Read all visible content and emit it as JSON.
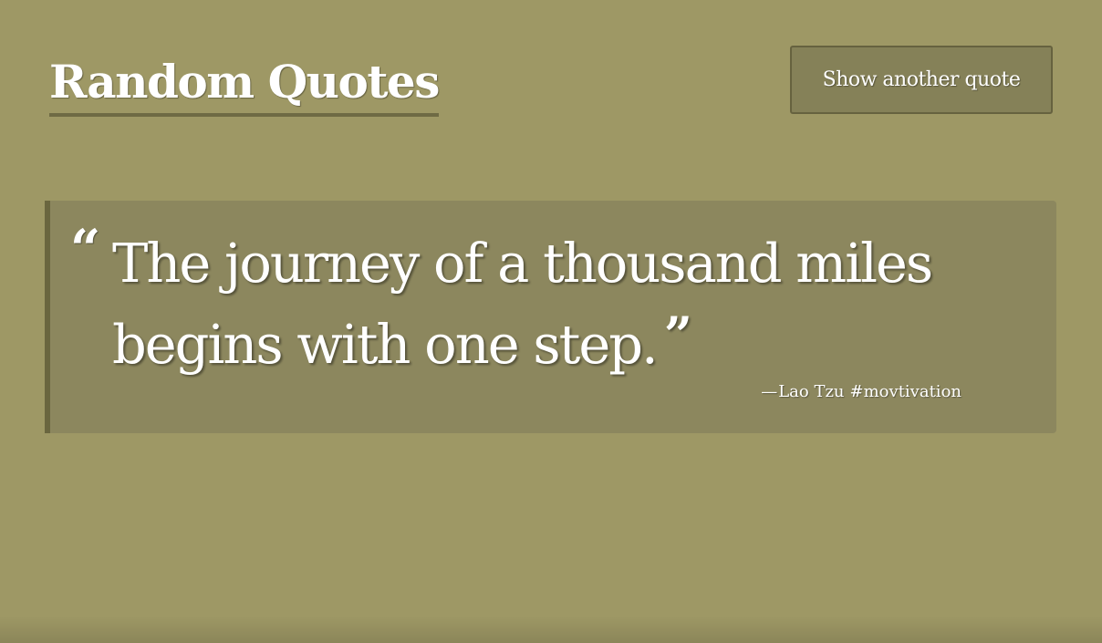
{
  "header": {
    "title": "Random Quotes",
    "next_button_label": "Show another quote"
  },
  "quote": {
    "open_mark": "“",
    "text": "The journey of a thousand miles begins with one step.",
    "close_mark": "”",
    "author_prefix": "—",
    "author": "Lao Tzu",
    "hashtag": "#movtivation"
  },
  "colors": {
    "background": "#9e9865",
    "card": "#8c875e",
    "accent": "#6a663f",
    "text": "#ffffff"
  }
}
